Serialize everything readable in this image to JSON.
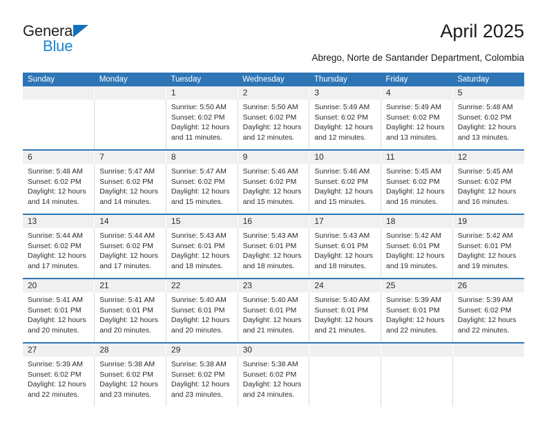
{
  "brand": {
    "name_part1": "General",
    "name_part2": "Blue",
    "accent_color": "#1b84d0",
    "triangle_color": "#1271bb"
  },
  "header": {
    "title": "April 2025",
    "subtitle": "Abrego, Norte de Santander Department, Colombia"
  },
  "calendar": {
    "header_bg": "#2e75b6",
    "date_band_bg": "#f0f0f0",
    "weekdays": [
      "Sunday",
      "Monday",
      "Tuesday",
      "Wednesday",
      "Thursday",
      "Friday",
      "Saturday"
    ],
    "weeks": [
      {
        "dates": [
          "",
          "",
          "1",
          "2",
          "3",
          "4",
          "5"
        ],
        "cells": [
          {
            "lines": []
          },
          {
            "lines": []
          },
          {
            "lines": [
              "Sunrise: 5:50 AM",
              "Sunset: 6:02 PM",
              "Daylight: 12 hours",
              "and 11 minutes."
            ]
          },
          {
            "lines": [
              "Sunrise: 5:50 AM",
              "Sunset: 6:02 PM",
              "Daylight: 12 hours",
              "and 12 minutes."
            ]
          },
          {
            "lines": [
              "Sunrise: 5:49 AM",
              "Sunset: 6:02 PM",
              "Daylight: 12 hours",
              "and 12 minutes."
            ]
          },
          {
            "lines": [
              "Sunrise: 5:49 AM",
              "Sunset: 6:02 PM",
              "Daylight: 12 hours",
              "and 13 minutes."
            ]
          },
          {
            "lines": [
              "Sunrise: 5:48 AM",
              "Sunset: 6:02 PM",
              "Daylight: 12 hours",
              "and 13 minutes."
            ]
          }
        ]
      },
      {
        "dates": [
          "6",
          "7",
          "8",
          "9",
          "10",
          "11",
          "12"
        ],
        "cells": [
          {
            "lines": [
              "Sunrise: 5:48 AM",
              "Sunset: 6:02 PM",
              "Daylight: 12 hours",
              "and 14 minutes."
            ]
          },
          {
            "lines": [
              "Sunrise: 5:47 AM",
              "Sunset: 6:02 PM",
              "Daylight: 12 hours",
              "and 14 minutes."
            ]
          },
          {
            "lines": [
              "Sunrise: 5:47 AM",
              "Sunset: 6:02 PM",
              "Daylight: 12 hours",
              "and 15 minutes."
            ]
          },
          {
            "lines": [
              "Sunrise: 5:46 AM",
              "Sunset: 6:02 PM",
              "Daylight: 12 hours",
              "and 15 minutes."
            ]
          },
          {
            "lines": [
              "Sunrise: 5:46 AM",
              "Sunset: 6:02 PM",
              "Daylight: 12 hours",
              "and 15 minutes."
            ]
          },
          {
            "lines": [
              "Sunrise: 5:45 AM",
              "Sunset: 6:02 PM",
              "Daylight: 12 hours",
              "and 16 minutes."
            ]
          },
          {
            "lines": [
              "Sunrise: 5:45 AM",
              "Sunset: 6:02 PM",
              "Daylight: 12 hours",
              "and 16 minutes."
            ]
          }
        ]
      },
      {
        "dates": [
          "13",
          "14",
          "15",
          "16",
          "17",
          "18",
          "19"
        ],
        "cells": [
          {
            "lines": [
              "Sunrise: 5:44 AM",
              "Sunset: 6:02 PM",
              "Daylight: 12 hours",
              "and 17 minutes."
            ]
          },
          {
            "lines": [
              "Sunrise: 5:44 AM",
              "Sunset: 6:02 PM",
              "Daylight: 12 hours",
              "and 17 minutes."
            ]
          },
          {
            "lines": [
              "Sunrise: 5:43 AM",
              "Sunset: 6:01 PM",
              "Daylight: 12 hours",
              "and 18 minutes."
            ]
          },
          {
            "lines": [
              "Sunrise: 5:43 AM",
              "Sunset: 6:01 PM",
              "Daylight: 12 hours",
              "and 18 minutes."
            ]
          },
          {
            "lines": [
              "Sunrise: 5:43 AM",
              "Sunset: 6:01 PM",
              "Daylight: 12 hours",
              "and 18 minutes."
            ]
          },
          {
            "lines": [
              "Sunrise: 5:42 AM",
              "Sunset: 6:01 PM",
              "Daylight: 12 hours",
              "and 19 minutes."
            ]
          },
          {
            "lines": [
              "Sunrise: 5:42 AM",
              "Sunset: 6:01 PM",
              "Daylight: 12 hours",
              "and 19 minutes."
            ]
          }
        ]
      },
      {
        "dates": [
          "20",
          "21",
          "22",
          "23",
          "24",
          "25",
          "26"
        ],
        "cells": [
          {
            "lines": [
              "Sunrise: 5:41 AM",
              "Sunset: 6:01 PM",
              "Daylight: 12 hours",
              "and 20 minutes."
            ]
          },
          {
            "lines": [
              "Sunrise: 5:41 AM",
              "Sunset: 6:01 PM",
              "Daylight: 12 hours",
              "and 20 minutes."
            ]
          },
          {
            "lines": [
              "Sunrise: 5:40 AM",
              "Sunset: 6:01 PM",
              "Daylight: 12 hours",
              "and 20 minutes."
            ]
          },
          {
            "lines": [
              "Sunrise: 5:40 AM",
              "Sunset: 6:01 PM",
              "Daylight: 12 hours",
              "and 21 minutes."
            ]
          },
          {
            "lines": [
              "Sunrise: 5:40 AM",
              "Sunset: 6:01 PM",
              "Daylight: 12 hours",
              "and 21 minutes."
            ]
          },
          {
            "lines": [
              "Sunrise: 5:39 AM",
              "Sunset: 6:01 PM",
              "Daylight: 12 hours",
              "and 22 minutes."
            ]
          },
          {
            "lines": [
              "Sunrise: 5:39 AM",
              "Sunset: 6:02 PM",
              "Daylight: 12 hours",
              "and 22 minutes."
            ]
          }
        ]
      },
      {
        "dates": [
          "27",
          "28",
          "29",
          "30",
          "",
          "",
          ""
        ],
        "cells": [
          {
            "lines": [
              "Sunrise: 5:39 AM",
              "Sunset: 6:02 PM",
              "Daylight: 12 hours",
              "and 22 minutes."
            ]
          },
          {
            "lines": [
              "Sunrise: 5:38 AM",
              "Sunset: 6:02 PM",
              "Daylight: 12 hours",
              "and 23 minutes."
            ]
          },
          {
            "lines": [
              "Sunrise: 5:38 AM",
              "Sunset: 6:02 PM",
              "Daylight: 12 hours",
              "and 23 minutes."
            ]
          },
          {
            "lines": [
              "Sunrise: 5:38 AM",
              "Sunset: 6:02 PM",
              "Daylight: 12 hours",
              "and 24 minutes."
            ]
          },
          {
            "lines": []
          },
          {
            "lines": []
          },
          {
            "lines": []
          }
        ]
      }
    ]
  }
}
